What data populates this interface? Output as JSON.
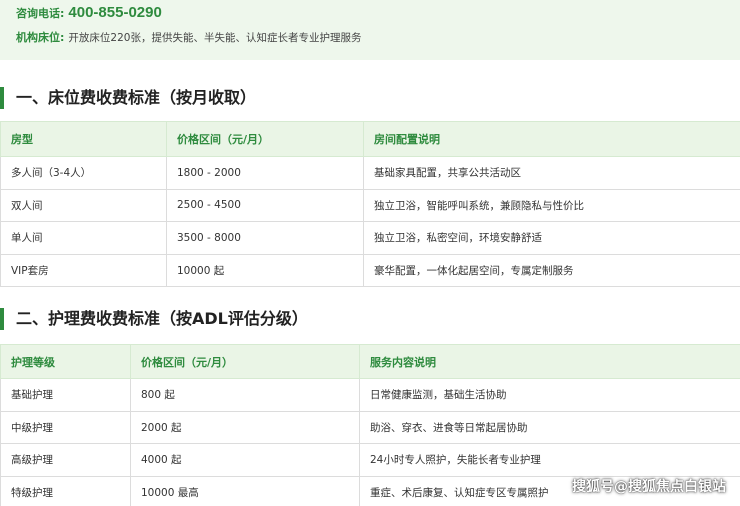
{
  "contact": {
    "phone_label": "咨询电话:",
    "phone": "400-855-0290",
    "beds_label": "机构床位:",
    "beds_text": "开放床位220张，提供失能、半失能、认知症长者专业护理服务"
  },
  "section1": {
    "title": "一、床位费收费标准（按月收取）",
    "headers": [
      "房型",
      "价格区间（元/月）",
      "房间配置说明"
    ],
    "rows": [
      [
        "多人间（3-4人）",
        "1800 - 2000",
        "基础家具配置，共享公共活动区"
      ],
      [
        "双人间",
        "2500 - 4500",
        "独立卫浴，智能呼叫系统，兼顾隐私与性价比"
      ],
      [
        "单人间",
        "3500 - 8000",
        "独立卫浴，私密空间，环境安静舒适"
      ],
      [
        "VIP套房",
        "10000 起",
        "豪华配置，一体化起居空间，专属定制服务"
      ]
    ]
  },
  "section2": {
    "title": "二、护理费收费标准（按ADL评估分级）",
    "headers": [
      "护理等级",
      "价格区间（元/月）",
      "服务内容说明"
    ],
    "rows": [
      [
        "基础护理",
        "800 起",
        "日常健康监测，基础生活协助"
      ],
      [
        "中级护理",
        "2000 起",
        "助浴、穿衣、进食等日常起居协助"
      ],
      [
        "高级护理",
        "4000 起",
        "24小时专人照护，失能长者专业护理"
      ],
      [
        "特级护理",
        "10000 最高",
        "重症、术后康复、认知症专区专属照护"
      ]
    ]
  },
  "watermark": "搜狐号@搜狐焦点白银站",
  "colors": {
    "accent": "#2e8b3e",
    "header_bg": "#eaf5e6",
    "info_bg": "#eef7ec"
  }
}
